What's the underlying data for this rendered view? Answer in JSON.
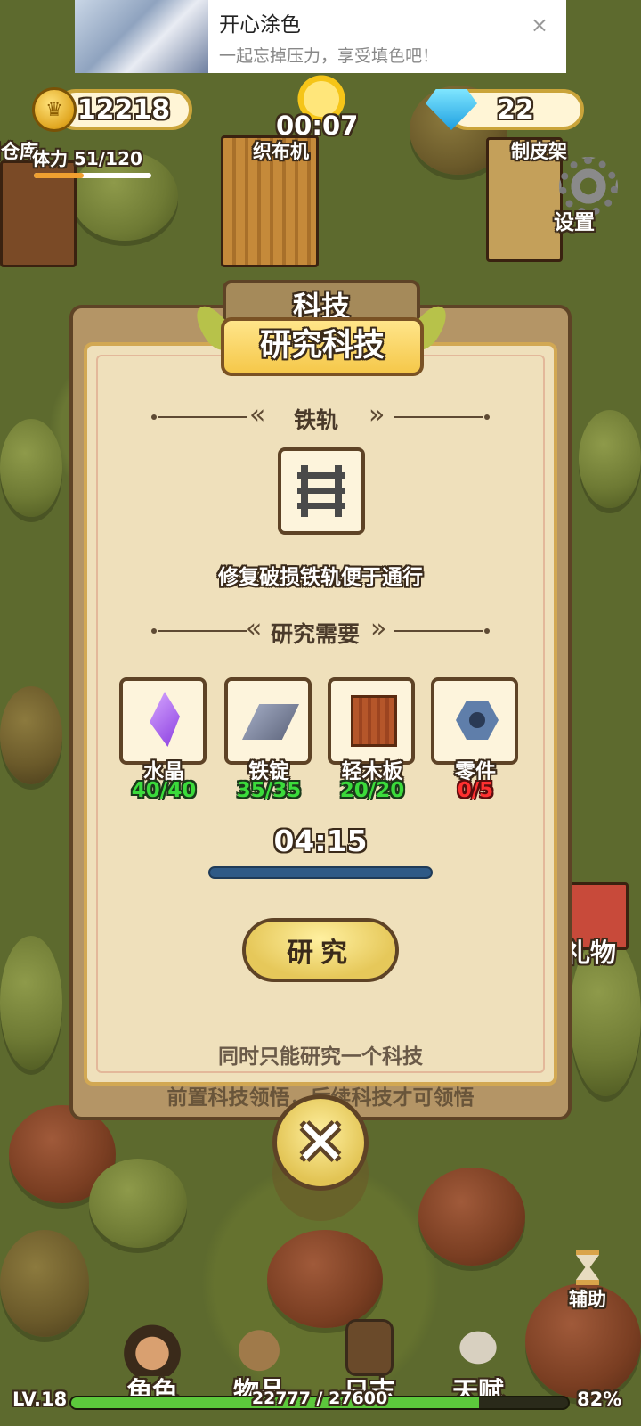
{
  "ad": {
    "title": "开心涂色",
    "subtitle": "一起忘掉压力，享受填色吧！",
    "close": "×"
  },
  "resources": {
    "coins": "12218",
    "gems": "22"
  },
  "hud": {
    "time": "00:07",
    "stamina_label": "体力",
    "stamina_value": "51/120",
    "stamina_level": 0.425,
    "settings_label": "设置"
  },
  "scene": {
    "labels": {
      "loom": "织布机",
      "tanning_rack": "制皮架",
      "warehouse": "旧仓库",
      "gift": "礼物"
    }
  },
  "modal": {
    "behind_title": "科技",
    "title": "研究科技",
    "tech_name": "铁轨",
    "tech_icon": "rail-track-icon",
    "description": "修复破损铁轨便于通行",
    "requirements_title": "研究需要",
    "materials": [
      {
        "name": "水晶",
        "count": "40/40",
        "icon": "crystal-icon",
        "satisfied": true
      },
      {
        "name": "铁锭",
        "count": "35/35",
        "icon": "iron-ingot-icon",
        "satisfied": true
      },
      {
        "name": "轻木板",
        "count": "20/20",
        "icon": "light-plank-icon",
        "satisfied": true
      },
      {
        "name": "零件",
        "count": "0/5",
        "icon": "parts-icon",
        "satisfied": false
      }
    ],
    "timer": "04:15",
    "research_button": "研究",
    "note": "同时只能研究一个科技",
    "note_behind": "前置科技领悟，后续科技才可领悟",
    "close_icon": "close-icon"
  },
  "nav": {
    "items": [
      {
        "label": "角色",
        "icon": "character-icon"
      },
      {
        "label": "物品",
        "icon": "items-bag-icon"
      },
      {
        "label": "日志",
        "icon": "journal-icon"
      },
      {
        "label": "天赋",
        "icon": "talent-wings-icon"
      }
    ],
    "assist_label": "辅助",
    "level": "LV.18",
    "xp": "22777 / 27600",
    "percent": "82%"
  },
  "colors": {
    "accent": "#e6c85a",
    "ok": "#3bdb3b",
    "lack": "#ff3030",
    "panel": "#efe0bb"
  }
}
